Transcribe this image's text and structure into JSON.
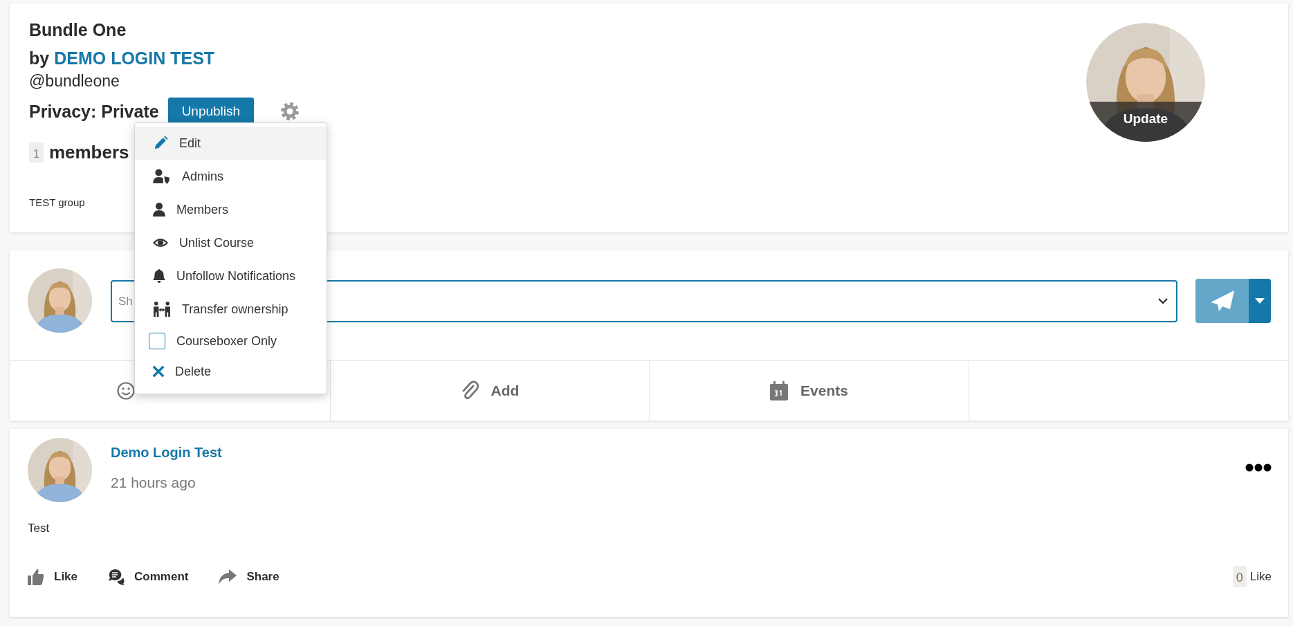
{
  "group": {
    "title": "Bundle One",
    "by_label": "by",
    "owner": "DEMO LOGIN TEST",
    "handle": "@bundleone",
    "privacy": "Privacy: Private",
    "publish_button": "Unpublish",
    "member_count": "1",
    "members_label": "members",
    "description": "TEST group",
    "avatar_button": "Update"
  },
  "settings_menu": {
    "items": [
      {
        "label": "Edit",
        "kind": "action",
        "selected": true
      },
      {
        "label": "Admins",
        "kind": "action",
        "selected": false
      },
      {
        "label": "Members",
        "kind": "action",
        "selected": false
      },
      {
        "label": "Unlist Course",
        "kind": "action",
        "selected": false
      },
      {
        "label": "Unfollow Notifications",
        "kind": "action",
        "selected": false
      },
      {
        "label": "Transfer ownership",
        "kind": "action",
        "selected": false
      },
      {
        "label": "Courseboxer Only",
        "kind": "checkbox",
        "checked": false,
        "selected": false
      },
      {
        "label": "Delete",
        "kind": "action",
        "selected": false
      }
    ]
  },
  "composer": {
    "placeholder": "Sh",
    "tabs": [
      {
        "kind": "icon_only"
      },
      {
        "kind": "labeled",
        "label": "Add"
      },
      {
        "kind": "labeled",
        "label": "Events"
      }
    ]
  },
  "post": {
    "author": "Demo Login Test",
    "time": "21 hours ago",
    "text": "Test",
    "actions": [
      "Like",
      "Comment",
      "Share"
    ],
    "like_count": "0",
    "like_label": "Like"
  }
}
